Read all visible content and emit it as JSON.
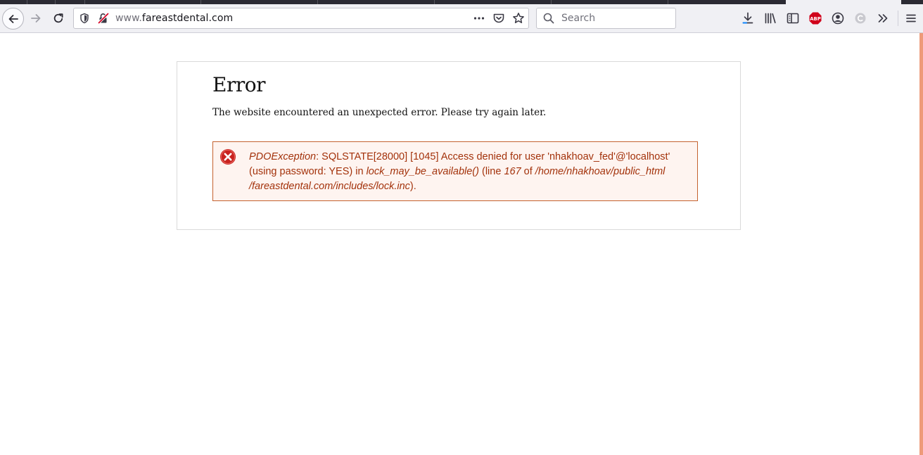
{
  "browser": {
    "url_prefix": "www.",
    "url_domain": "fareastdental.com",
    "search_placeholder": "Search",
    "abp_label": "ABP"
  },
  "page": {
    "title": "Error",
    "description": "The website encountered an unexpected error. Please try again later.",
    "message": {
      "exception": "PDOException",
      "text_1": ": SQLSTATE[28000] [1045] Access denied for user 'nhakhoav_fed'@'localhost' (using password: YES) in ",
      "function": "lock_may_be_available()",
      "text_2": " (line ",
      "line": "167",
      "text_3": " of ",
      "path": "/home/nhakhoav/public_html /fareastdental.com/includes/lock.inc",
      "text_4": ")."
    }
  },
  "colors": {
    "error_text": "#a3320b",
    "error_border": "#c4622f",
    "error_bg": "#fef4f0",
    "error_icon": "#c9221f"
  }
}
